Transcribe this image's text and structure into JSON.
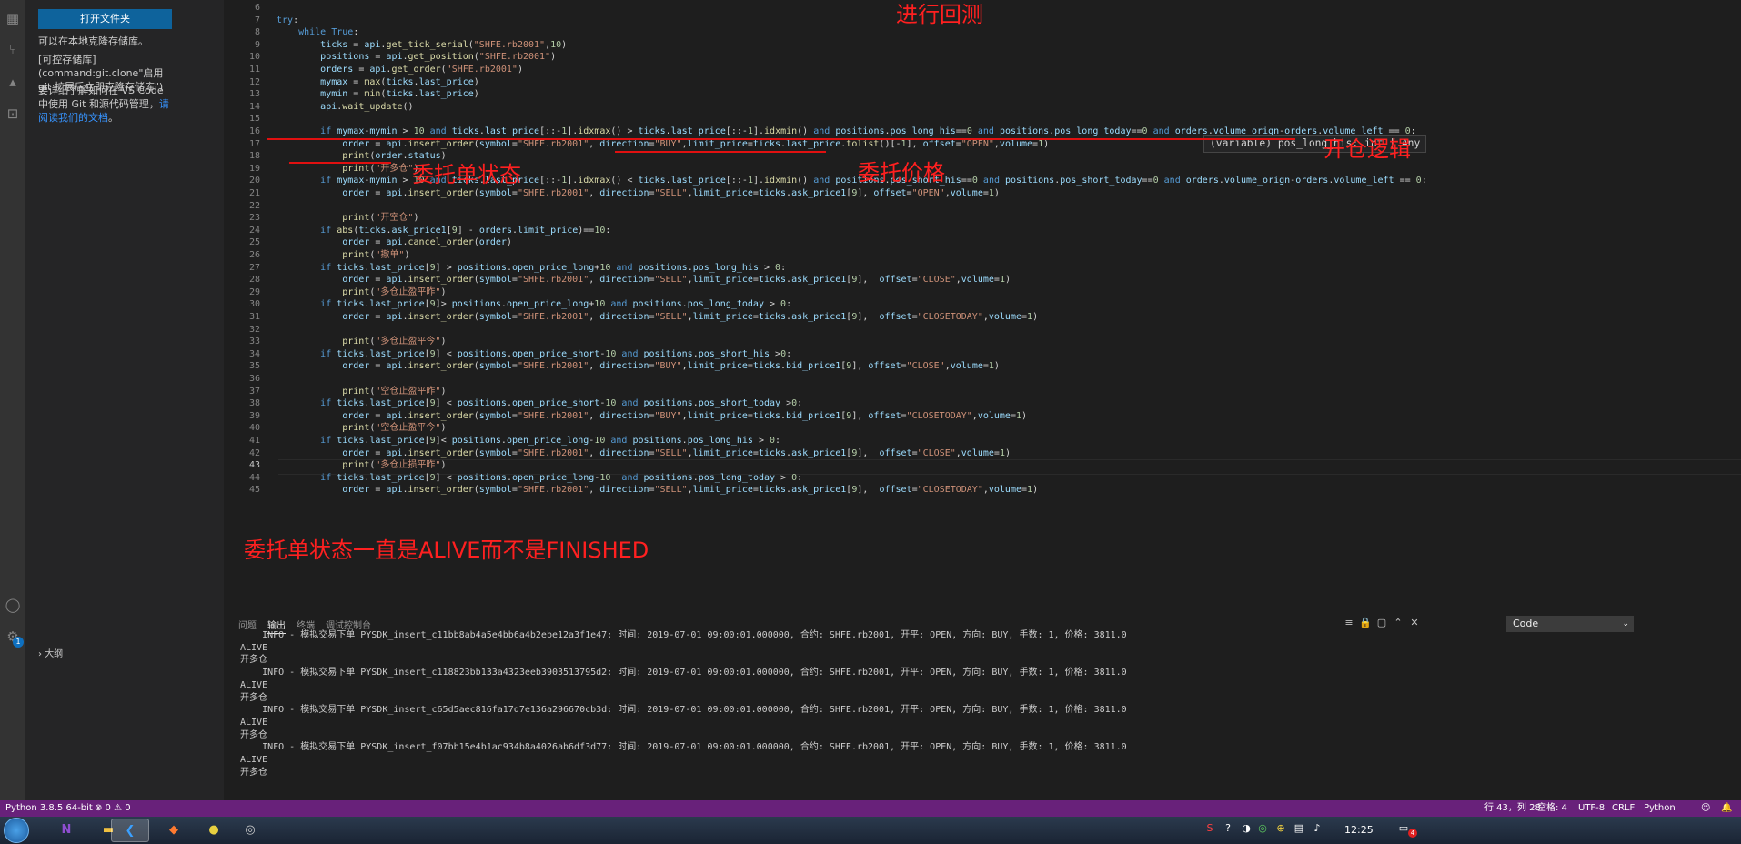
{
  "sidebar": {
    "open_folder_button": "打开文件夹",
    "text1": "可以在本地克隆存储库。",
    "text2": "[可控存储库](command:git.clone\"启用 git 扩展后立即克隆存储库\")",
    "text3": "要详细了解如何在 VS Code 中使用 Git 和源代码管理，",
    "text3_link": "请阅读我们的文档",
    "text3_end": "。",
    "outline_label": "大纲",
    "accounts_badge": "1"
  },
  "editor": {
    "lines": [
      {
        "n": "6",
        "html": ""
      },
      {
        "n": "7",
        "html": "<span class=\"kw\">try</span>:"
      },
      {
        "n": "8",
        "html": "    <span class=\"kw\">while</span> <span class=\"kw\">True</span>:"
      },
      {
        "n": "9",
        "html": "        <span class=\"var\">ticks</span> = <span class=\"var\">api</span>.<span class=\"fn\">get_tick_serial</span>(<span class=\"str\">\"SHFE.rb2001\"</span>,<span class=\"num\">10</span>)"
      },
      {
        "n": "10",
        "html": "        <span class=\"var\">positions</span> = <span class=\"var\">api</span>.<span class=\"fn\">get_position</span>(<span class=\"str\">\"SHFE.rb2001\"</span>)"
      },
      {
        "n": "11",
        "html": "        <span class=\"var\">orders</span> = <span class=\"var\">api</span>.<span class=\"fn\">get_order</span>(<span class=\"str\">\"SHFE.rb2001\"</span>)"
      },
      {
        "n": "12",
        "html": "        <span class=\"var\">mymax</span> = <span class=\"fn\">max</span>(<span class=\"var\">ticks</span>.<span class=\"var\">last_price</span>)"
      },
      {
        "n": "13",
        "html": "        <span class=\"var\">mymin</span> = <span class=\"fn\">min</span>(<span class=\"var\">ticks</span>.<span class=\"var\">last_price</span>)"
      },
      {
        "n": "14",
        "html": "        <span class=\"var\">api</span>.<span class=\"fn\">wait_update</span>()"
      },
      {
        "n": "15",
        "html": ""
      },
      {
        "n": "16",
        "html": "        <span class=\"kw\">if</span> <span class=\"var\">mymax</span>-<span class=\"var\">mymin</span> &gt; <span class=\"num\">10</span> <span class=\"kw\">and</span> <span class=\"var\">ticks</span>.<span class=\"var\">last_price</span>[::-<span class=\"num\">1</span>].<span class=\"fn\">idxmax</span>() &gt; <span class=\"var\">ticks</span>.<span class=\"var\">last_price</span>[::-<span class=\"num\">1</span>].<span class=\"fn\">idxmin</span>() <span class=\"kw\">and</span> <span class=\"var\">positions</span>.<span class=\"var\">pos_long_his</span>==<span class=\"num\">0</span> <span class=\"kw\">and</span> <span class=\"var\">positions</span>.<span class=\"var\">pos_long_today</span>==<span class=\"num\">0</span> <span class=\"kw\">and</span> <span class=\"var\">orders</span>.<span class=\"var\">volume_orign</span>-<span class=\"var\">orders</span>.<span class=\"var\">volume_left</span> == <span class=\"num\">0</span>:"
      },
      {
        "n": "17",
        "html": "            <span class=\"var\">order</span> = <span class=\"var\">api</span>.<span class=\"fn\">insert_order</span>(<span class=\"var\">symbol</span>=<span class=\"str\">\"SHFE.rb2001\"</span>, <span class=\"var\">direction</span>=<span class=\"str\">\"BUY\"</span>,<span class=\"var\">limit_price</span>=<span class=\"var\">ticks</span>.<span class=\"var\">last_price</span>.<span class=\"fn\">tolist</span>()[-<span class=\"num\">1</span>], <span class=\"var\">offset</span>=<span class=\"str\">\"OPEN\"</span>,<span class=\"var\">volume</span>=<span class=\"num\">1</span>)"
      },
      {
        "n": "18",
        "html": "            <span class=\"fn\">print</span>(<span class=\"var\">order</span>.<span class=\"var\">status</span>)"
      },
      {
        "n": "19",
        "html": "            <span class=\"fn\">print</span>(<span class=\"str\">\"开多仓\"</span>)"
      },
      {
        "n": "20",
        "html": "        <span class=\"kw\">if</span> <span class=\"var\">mymax</span>-<span class=\"var\">mymin</span> &gt; <span class=\"num\">10</span> <span class=\"kw\">and</span> <span class=\"var\">ticks</span>.<span class=\"var\">last_price</span>[::-<span class=\"num\">1</span>].<span class=\"fn\">idxmax</span>() &lt; <span class=\"var\">ticks</span>.<span class=\"var\">last_price</span>[::-<span class=\"num\">1</span>].<span class=\"fn\">idxmin</span>() <span class=\"kw\">and</span> <span class=\"var\">positions</span>.<span class=\"var\">pos_short_his</span>==<span class=\"num\">0</span> <span class=\"kw\">and</span> <span class=\"var\">positions</span>.<span class=\"var\">pos_short_today</span>==<span class=\"num\">0</span> <span class=\"kw\">and</span> <span class=\"var\">orders</span>.<span class=\"var\">volume_orign</span>-<span class=\"var\">orders</span>.<span class=\"var\">volume_left</span> == <span class=\"num\">0</span>:"
      },
      {
        "n": "21",
        "html": "            <span class=\"var\">order</span> = <span class=\"var\">api</span>.<span class=\"fn\">insert_order</span>(<span class=\"var\">symbol</span>=<span class=\"str\">\"SHFE.rb2001\"</span>, <span class=\"var\">direction</span>=<span class=\"str\">\"SELL\"</span>,<span class=\"var\">limit_price</span>=<span class=\"var\">ticks</span>.<span class=\"var\">ask_price1</span>[<span class=\"num\">9</span>], <span class=\"var\">offset</span>=<span class=\"str\">\"OPEN\"</span>,<span class=\"var\">volume</span>=<span class=\"num\">1</span>)"
      },
      {
        "n": "22",
        "html": ""
      },
      {
        "n": "23",
        "html": "            <span class=\"fn\">print</span>(<span class=\"str\">\"开空仓\"</span>)"
      },
      {
        "n": "24",
        "html": "        <span class=\"kw\">if</span> <span class=\"fn\">abs</span>(<span class=\"var\">ticks</span>.<span class=\"var\">ask_price1</span>[<span class=\"num\">9</span>] - <span class=\"var\">orders</span>.<span class=\"var\">limit_price</span>)==<span class=\"num\">10</span>:"
      },
      {
        "n": "25",
        "html": "            <span class=\"var\">order</span> = <span class=\"var\">api</span>.<span class=\"fn\">cancel_order</span>(<span class=\"var\">order</span>)"
      },
      {
        "n": "26",
        "html": "            <span class=\"fn\">print</span>(<span class=\"str\">\"撤单\"</span>)"
      },
      {
        "n": "27",
        "html": "        <span class=\"kw\">if</span> <span class=\"var\">ticks</span>.<span class=\"var\">last_price</span>[<span class=\"num\">9</span>] &gt; <span class=\"var\">positions</span>.<span class=\"var\">open_price_long</span>+<span class=\"num\">10</span> <span class=\"kw\">and</span> <span class=\"var\">positions</span>.<span class=\"var\">pos_long_his</span> &gt; <span class=\"num\">0</span>:"
      },
      {
        "n": "28",
        "html": "            <span class=\"var\">order</span> = <span class=\"var\">api</span>.<span class=\"fn\">insert_order</span>(<span class=\"var\">symbol</span>=<span class=\"str\">\"SHFE.rb2001\"</span>, <span class=\"var\">direction</span>=<span class=\"str\">\"SELL\"</span>,<span class=\"var\">limit_price</span>=<span class=\"var\">ticks</span>.<span class=\"var\">ask_price1</span>[<span class=\"num\">9</span>],  <span class=\"var\">offset</span>=<span class=\"str\">\"CLOSE\"</span>,<span class=\"var\">volume</span>=<span class=\"num\">1</span>)"
      },
      {
        "n": "29",
        "html": "            <span class=\"fn\">print</span>(<span class=\"str\">\"多仓止盈平昨\"</span>)"
      },
      {
        "n": "30",
        "html": "        <span class=\"kw\">if</span> <span class=\"var\">ticks</span>.<span class=\"var\">last_price</span>[<span class=\"num\">9</span>]&gt; <span class=\"var\">positions</span>.<span class=\"var\">open_price_long</span>+<span class=\"num\">10</span> <span class=\"kw\">and</span> <span class=\"var\">positions</span>.<span class=\"var\">pos_long_today</span> &gt; <span class=\"num\">0</span>:"
      },
      {
        "n": "31",
        "html": "            <span class=\"var\">order</span> = <span class=\"var\">api</span>.<span class=\"fn\">insert_order</span>(<span class=\"var\">symbol</span>=<span class=\"str\">\"SHFE.rb2001\"</span>, <span class=\"var\">direction</span>=<span class=\"str\">\"SELL\"</span>,<span class=\"var\">limit_price</span>=<span class=\"var\">ticks</span>.<span class=\"var\">ask_price1</span>[<span class=\"num\">9</span>],  <span class=\"var\">offset</span>=<span class=\"str\">\"CLOSETODAY\"</span>,<span class=\"var\">volume</span>=<span class=\"num\">1</span>)"
      },
      {
        "n": "32",
        "html": ""
      },
      {
        "n": "33",
        "html": "            <span class=\"fn\">print</span>(<span class=\"str\">\"多仓止盈平今\"</span>)"
      },
      {
        "n": "34",
        "html": "        <span class=\"kw\">if</span> <span class=\"var\">ticks</span>.<span class=\"var\">last_price</span>[<span class=\"num\">9</span>] &lt; <span class=\"var\">positions</span>.<span class=\"var\">open_price_short</span>-<span class=\"num\">10</span> <span class=\"kw\">and</span> <span class=\"var\">positions</span>.<span class=\"var\">pos_short_his</span> &gt;<span class=\"num\">0</span>:"
      },
      {
        "n": "35",
        "html": "            <span class=\"var\">order</span> = <span class=\"var\">api</span>.<span class=\"fn\">insert_order</span>(<span class=\"var\">symbol</span>=<span class=\"str\">\"SHFE.rb2001\"</span>, <span class=\"var\">direction</span>=<span class=\"str\">\"BUY\"</span>,<span class=\"var\">limit_price</span>=<span class=\"var\">ticks</span>.<span class=\"var\">bid_price1</span>[<span class=\"num\">9</span>], <span class=\"var\">offset</span>=<span class=\"str\">\"CLOSE\"</span>,<span class=\"var\">volume</span>=<span class=\"num\">1</span>)"
      },
      {
        "n": "36",
        "html": ""
      },
      {
        "n": "37",
        "html": "            <span class=\"fn\">print</span>(<span class=\"str\">\"空仓止盈平昨\"</span>)"
      },
      {
        "n": "38",
        "html": "        <span class=\"kw\">if</span> <span class=\"var\">ticks</span>.<span class=\"var\">last_price</span>[<span class=\"num\">9</span>] &lt; <span class=\"var\">positions</span>.<span class=\"var\">open_price_short</span>-<span class=\"num\">10</span> <span class=\"kw\">and</span> <span class=\"var\">positions</span>.<span class=\"var\">pos_short_today</span> &gt;<span class=\"num\">0</span>:"
      },
      {
        "n": "39",
        "html": "            <span class=\"var\">order</span> = <span class=\"var\">api</span>.<span class=\"fn\">insert_order</span>(<span class=\"var\">symbol</span>=<span class=\"str\">\"SHFE.rb2001\"</span>, <span class=\"var\">direction</span>=<span class=\"str\">\"BUY\"</span>,<span class=\"var\">limit_price</span>=<span class=\"var\">ticks</span>.<span class=\"var\">bid_price1</span>[<span class=\"num\">9</span>], <span class=\"var\">offset</span>=<span class=\"str\">\"CLOSETODAY\"</span>,<span class=\"var\">volume</span>=<span class=\"num\">1</span>)"
      },
      {
        "n": "40",
        "html": "            <span class=\"fn\">print</span>(<span class=\"str\">\"空仓止盈平今\"</span>)"
      },
      {
        "n": "41",
        "html": "        <span class=\"kw\">if</span> <span class=\"var\">ticks</span>.<span class=\"var\">last_price</span>[<span class=\"num\">9</span>]&lt; <span class=\"var\">positions</span>.<span class=\"var\">open_price_long</span>-<span class=\"num\">10</span> <span class=\"kw\">and</span> <span class=\"var\">positions</span>.<span class=\"var\">pos_long_his</span> &gt; <span class=\"num\">0</span>:"
      },
      {
        "n": "42",
        "html": "            <span class=\"var\">order</span> = <span class=\"var\">api</span>.<span class=\"fn\">insert_order</span>(<span class=\"var\">symbol</span>=<span class=\"str\">\"SHFE.rb2001\"</span>, <span class=\"var\">direction</span>=<span class=\"str\">\"SELL\"</span>,<span class=\"var\">limit_price</span>=<span class=\"var\">ticks</span>.<span class=\"var\">ask_price1</span>[<span class=\"num\">9</span>],  <span class=\"var\">offset</span>=<span class=\"str\">\"CLOSE\"</span>,<span class=\"var\">volume</span>=<span class=\"num\">1</span>)"
      },
      {
        "n": "43",
        "html": "            <span class=\"fn\">print</span>(<span class=\"str\">\"多仓止损平昨\"</span>)"
      },
      {
        "n": "44",
        "html": "        <span class=\"kw\">if</span> <span class=\"var\">ticks</span>.<span class=\"var\">last_price</span>[<span class=\"num\">9</span>] &lt; <span class=\"var\">positions</span>.<span class=\"var\">open_price_long</span>-<span class=\"num\">10</span>  <span class=\"kw\">and</span> <span class=\"var\">positions</span>.<span class=\"var\">pos_long_today</span> &gt; <span class=\"num\">0</span>:"
      },
      {
        "n": "45",
        "html": "            <span class=\"var\">order</span> = <span class=\"var\">api</span>.<span class=\"fn\">insert_order</span>(<span class=\"var\">symbol</span>=<span class=\"str\">\"SHFE.rb2001\"</span>, <span class=\"var\">direction</span>=<span class=\"str\">\"SELL\"</span>,<span class=\"var\">limit_price</span>=<span class=\"var\">ticks</span>.<span class=\"var\">ask_price1</span>[<span class=\"num\">9</span>],  <span class=\"var\">offset</span>=<span class=\"str\">\"CLOSETODAY\"</span>,<span class=\"var\">volume</span>=<span class=\"num\">1</span>)"
      }
    ],
    "active_line": "43",
    "hover_text": "(variable) pos_long_his: int | Any"
  },
  "annotations": {
    "backtest": "进行回测",
    "open_logic": "开仓逻辑",
    "order_status": "委托单状态",
    "order_price": "委托价格",
    "status_note": "委托单状态一直是ALIVE而不是FINISHED"
  },
  "panel": {
    "tabs": [
      "问题",
      "输出",
      "终端",
      "调试控制台"
    ],
    "active_tab": "输出",
    "dropdown_value": "Code",
    "output_lines": [
      "    INFO - 模拟交易下单 PYSDK_insert_c11bb8ab4a5e4bb6a4b2ebe12a3f1e47: 时间: 2019-07-01 09:00:01.000000, 合约: SHFE.rb2001, 开平: OPEN, 方向: BUY, 手数: 1, 价格: 3811.0",
      "ALIVE",
      "开多仓",
      "    INFO - 模拟交易下单 PYSDK_insert_c118823bb133a4323eeb3903513795d2: 时间: 2019-07-01 09:00:01.000000, 合约: SHFE.rb2001, 开平: OPEN, 方向: BUY, 手数: 1, 价格: 3811.0",
      "ALIVE",
      "开多仓",
      "    INFO - 模拟交易下单 PYSDK_insert_c65d5aec816fa17d7e136a296670cb3d: 时间: 2019-07-01 09:00:01.000000, 合约: SHFE.rb2001, 开平: OPEN, 方向: BUY, 手数: 1, 价格: 3811.0",
      "ALIVE",
      "开多仓",
      "    INFO - 模拟交易下单 PYSDK_insert_f07bb15e4b1ac934b8a4026ab6df3d77: 时间: 2019-07-01 09:00:01.000000, 合约: SHFE.rb2001, 开平: OPEN, 方向: BUY, 手数: 1, 价格: 3811.0",
      "ALIVE",
      "开多仓"
    ]
  },
  "statusbar": {
    "python": "Python 3.8.5 64-bit",
    "problems": "⊗ 0 ⚠ 0",
    "position": "行 43，列 28",
    "spaces": "空格: 4",
    "encoding": "UTF-8",
    "eol": "CRLF",
    "language": "Python"
  },
  "taskbar": {
    "time": "12:25",
    "notification_badge": "4"
  },
  "colors": {
    "statusbar": "#68217a",
    "annotation": "#ff2020",
    "button": "#0e639c"
  }
}
